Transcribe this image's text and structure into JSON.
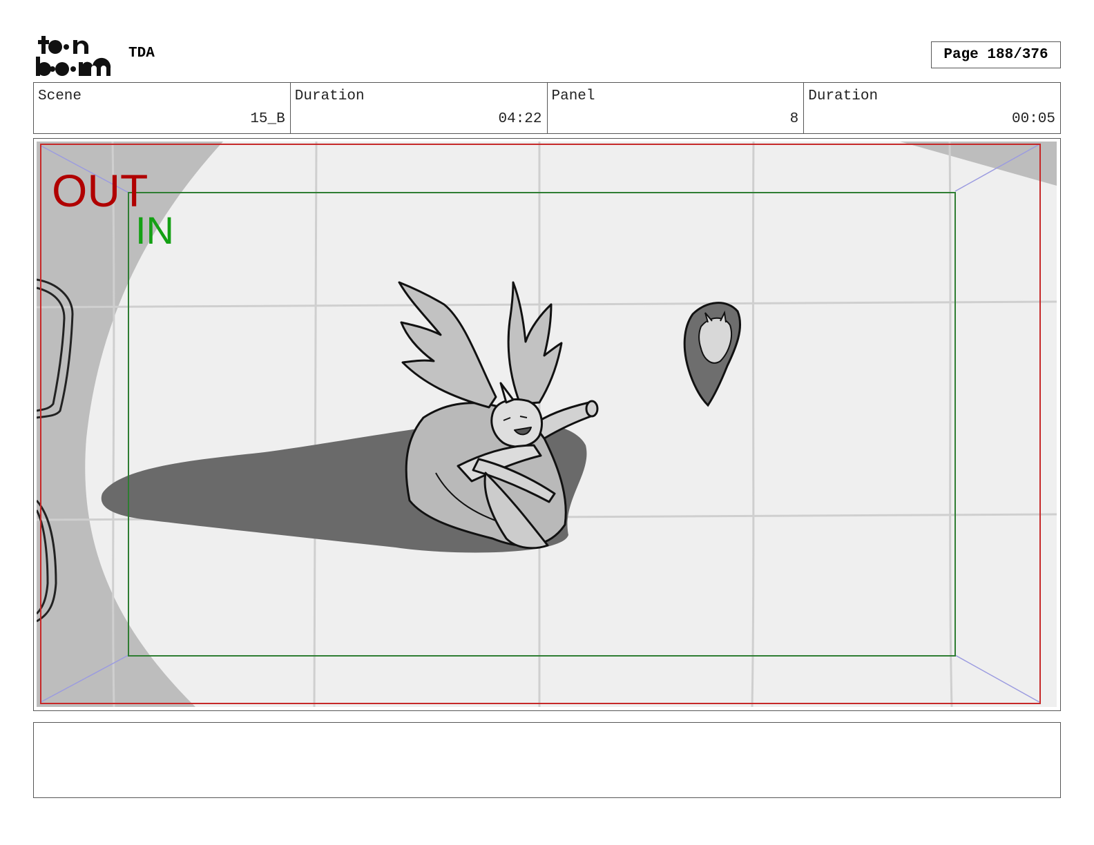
{
  "header": {
    "logo_text": "toon boom",
    "project_title": "TDA",
    "page_label": "Page 188/376"
  },
  "info": [
    {
      "label": "Scene",
      "value": "15_B"
    },
    {
      "label": "Duration",
      "value": "04:22"
    },
    {
      "label": "Panel",
      "value": "8"
    },
    {
      "label": "Duration",
      "value": "00:05"
    }
  ],
  "panel": {
    "out_label": "OUT",
    "in_label": "IN",
    "out_color": "#b00000",
    "in_color": "#14a014",
    "safe_frame_color": "#2e7d32",
    "border_color": "#c62828"
  },
  "notes": ""
}
